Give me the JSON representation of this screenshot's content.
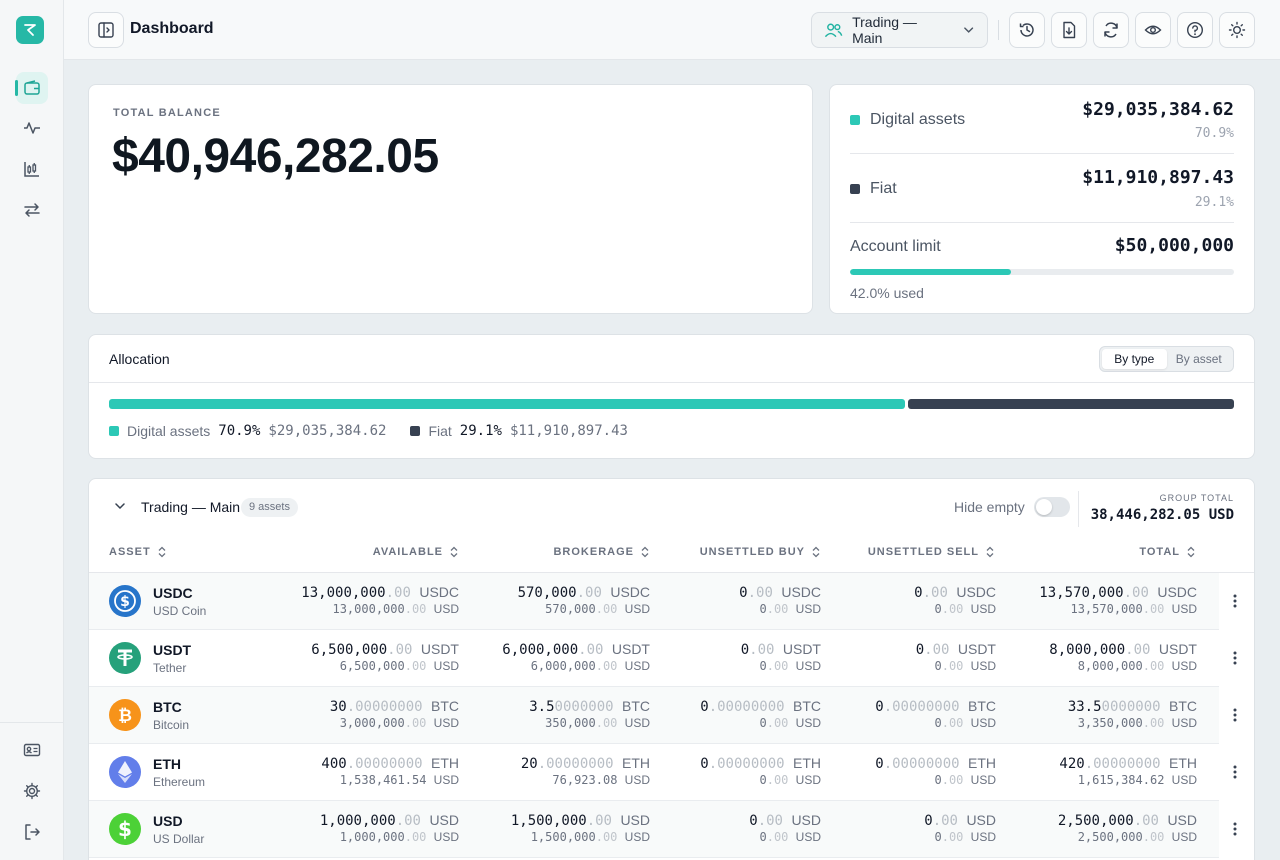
{
  "header": {
    "title": "Dashboard",
    "account": "Trading — Main"
  },
  "total_balance": {
    "label": "TOTAL BALANCE",
    "value": "$40,946,282.05"
  },
  "breakdown": {
    "digital": {
      "label": "Digital assets",
      "value": "$29,035,384.62",
      "pct": "70.9%",
      "color": "#2cc8b6"
    },
    "fiat": {
      "label": "Fiat",
      "value": "$11,910,897.43",
      "pct": "29.1%",
      "color": "#374151"
    },
    "limit": {
      "label": "Account limit",
      "value": "$50,000,000",
      "used_text": "42.0% used",
      "used_fraction": 0.42
    }
  },
  "allocation": {
    "title": "Allocation",
    "tabs": [
      "By type",
      "By asset"
    ],
    "active_tab": "By type",
    "segments": [
      {
        "name": "Digital assets",
        "pct": "70.9%",
        "amount": "$29,035,384.62",
        "fraction": 0.709,
        "color": "#2cc8b6"
      },
      {
        "name": "Fiat",
        "pct": "29.1%",
        "amount": "$11,910,897.43",
        "fraction": 0.291,
        "color": "#374151"
      }
    ]
  },
  "holdings": {
    "group_name": "Trading — Main",
    "asset_count": "9 assets",
    "hide_empty_label": "Hide empty",
    "hide_empty_on": false,
    "group_total_label": "GROUP TOTAL",
    "group_total": "38,446,282.05 USD",
    "columns": [
      "ASSET",
      "AVAILABLE",
      "BROKERAGE",
      "UNSETTLED BUY",
      "UNSETTLED SELL",
      "TOTAL"
    ],
    "rows": [
      {
        "symbol": "USDC",
        "name": "USD Coin",
        "icon": "usdc-icon",
        "color": "#2775ca",
        "available": {
          "int": "13,000,000",
          "dec": ".00",
          "cur": "USDC",
          "usd_int": "13,000,000",
          "usd_dec": ".00"
        },
        "brokerage": {
          "int": "570,000",
          "dec": ".00",
          "cur": "USDC",
          "usd_int": "570,000",
          "usd_dec": ".00"
        },
        "unsettled_buy": {
          "int": "0",
          "dec": ".00",
          "cur": "USDC",
          "usd_int": "0",
          "usd_dec": ".00"
        },
        "unsettled_sell": {
          "int": "0",
          "dec": ".00",
          "cur": "USDC",
          "usd_int": "0",
          "usd_dec": ".00"
        },
        "total": {
          "int": "13,570,000",
          "dec": ".00",
          "cur": "USDC",
          "usd_int": "13,570,000",
          "usd_dec": ".00"
        }
      },
      {
        "symbol": "USDT",
        "name": "Tether",
        "icon": "usdt-icon",
        "color": "#26a17b",
        "available": {
          "int": "6,500,000",
          "dec": ".00",
          "cur": "USDT",
          "usd_int": "6,500,000",
          "usd_dec": ".00"
        },
        "brokerage": {
          "int": "6,000,000",
          "dec": ".00",
          "cur": "USDT",
          "usd_int": "6,000,000",
          "usd_dec": ".00"
        },
        "unsettled_buy": {
          "int": "0",
          "dec": ".00",
          "cur": "USDT",
          "usd_int": "0",
          "usd_dec": ".00"
        },
        "unsettled_sell": {
          "int": "0",
          "dec": ".00",
          "cur": "USDT",
          "usd_int": "0",
          "usd_dec": ".00"
        },
        "total": {
          "int": "8,000,000",
          "dec": ".00",
          "cur": "USDT",
          "usd_int": "8,000,000",
          "usd_dec": ".00"
        }
      },
      {
        "symbol": "BTC",
        "name": "Bitcoin",
        "icon": "btc-icon",
        "color": "#f7931a",
        "available": {
          "int": "30",
          "dec": ".00000000",
          "cur": "BTC",
          "usd_int": "3,000,000",
          "usd_dec": ".00"
        },
        "brokerage": {
          "int": "3.5",
          "dec": "0000000",
          "cur": "BTC",
          "usd_int": "350,000",
          "usd_dec": ".00"
        },
        "unsettled_buy": {
          "int": "0",
          "dec": ".00000000",
          "cur": "BTC",
          "usd_int": "0",
          "usd_dec": ".00"
        },
        "unsettled_sell": {
          "int": "0",
          "dec": ".00000000",
          "cur": "BTC",
          "usd_int": "0",
          "usd_dec": ".00"
        },
        "total": {
          "int": "33.5",
          "dec": "0000000",
          "cur": "BTC",
          "usd_int": "3,350,000",
          "usd_dec": ".00"
        }
      },
      {
        "symbol": "ETH",
        "name": "Ethereum",
        "icon": "eth-icon",
        "color": "#627eea",
        "available": {
          "int": "400",
          "dec": ".00000000",
          "cur": "ETH",
          "usd_int": "1,538,461.54",
          "usd_dec": ""
        },
        "brokerage": {
          "int": "20",
          "dec": ".00000000",
          "cur": "ETH",
          "usd_int": "76,923.08",
          "usd_dec": ""
        },
        "unsettled_buy": {
          "int": "0",
          "dec": ".00000000",
          "cur": "ETH",
          "usd_int": "0",
          "usd_dec": ".00"
        },
        "unsettled_sell": {
          "int": "0",
          "dec": ".00000000",
          "cur": "ETH",
          "usd_int": "0",
          "usd_dec": ".00"
        },
        "total": {
          "int": "420",
          "dec": ".00000000",
          "cur": "ETH",
          "usd_int": "1,615,384.62",
          "usd_dec": ""
        }
      },
      {
        "symbol": "USD",
        "name": "US Dollar",
        "icon": "usd-icon",
        "color": "#4cd137",
        "available": {
          "int": "1,000,000",
          "dec": ".00",
          "cur": "USD",
          "usd_int": "1,000,000",
          "usd_dec": ".00"
        },
        "brokerage": {
          "int": "1,500,000",
          "dec": ".00",
          "cur": "USD",
          "usd_int": "1,500,000",
          "usd_dec": ".00"
        },
        "unsettled_buy": {
          "int": "0",
          "dec": ".00",
          "cur": "USD",
          "usd_int": "0",
          "usd_dec": ".00"
        },
        "unsettled_sell": {
          "int": "0",
          "dec": ".00",
          "cur": "USD",
          "usd_int": "0",
          "usd_dec": ".00"
        },
        "total": {
          "int": "2,500,000",
          "dec": ".00",
          "cur": "USD",
          "usd_int": "2,500,000",
          "usd_dec": ".00"
        }
      }
    ]
  },
  "usd_label": "USD"
}
